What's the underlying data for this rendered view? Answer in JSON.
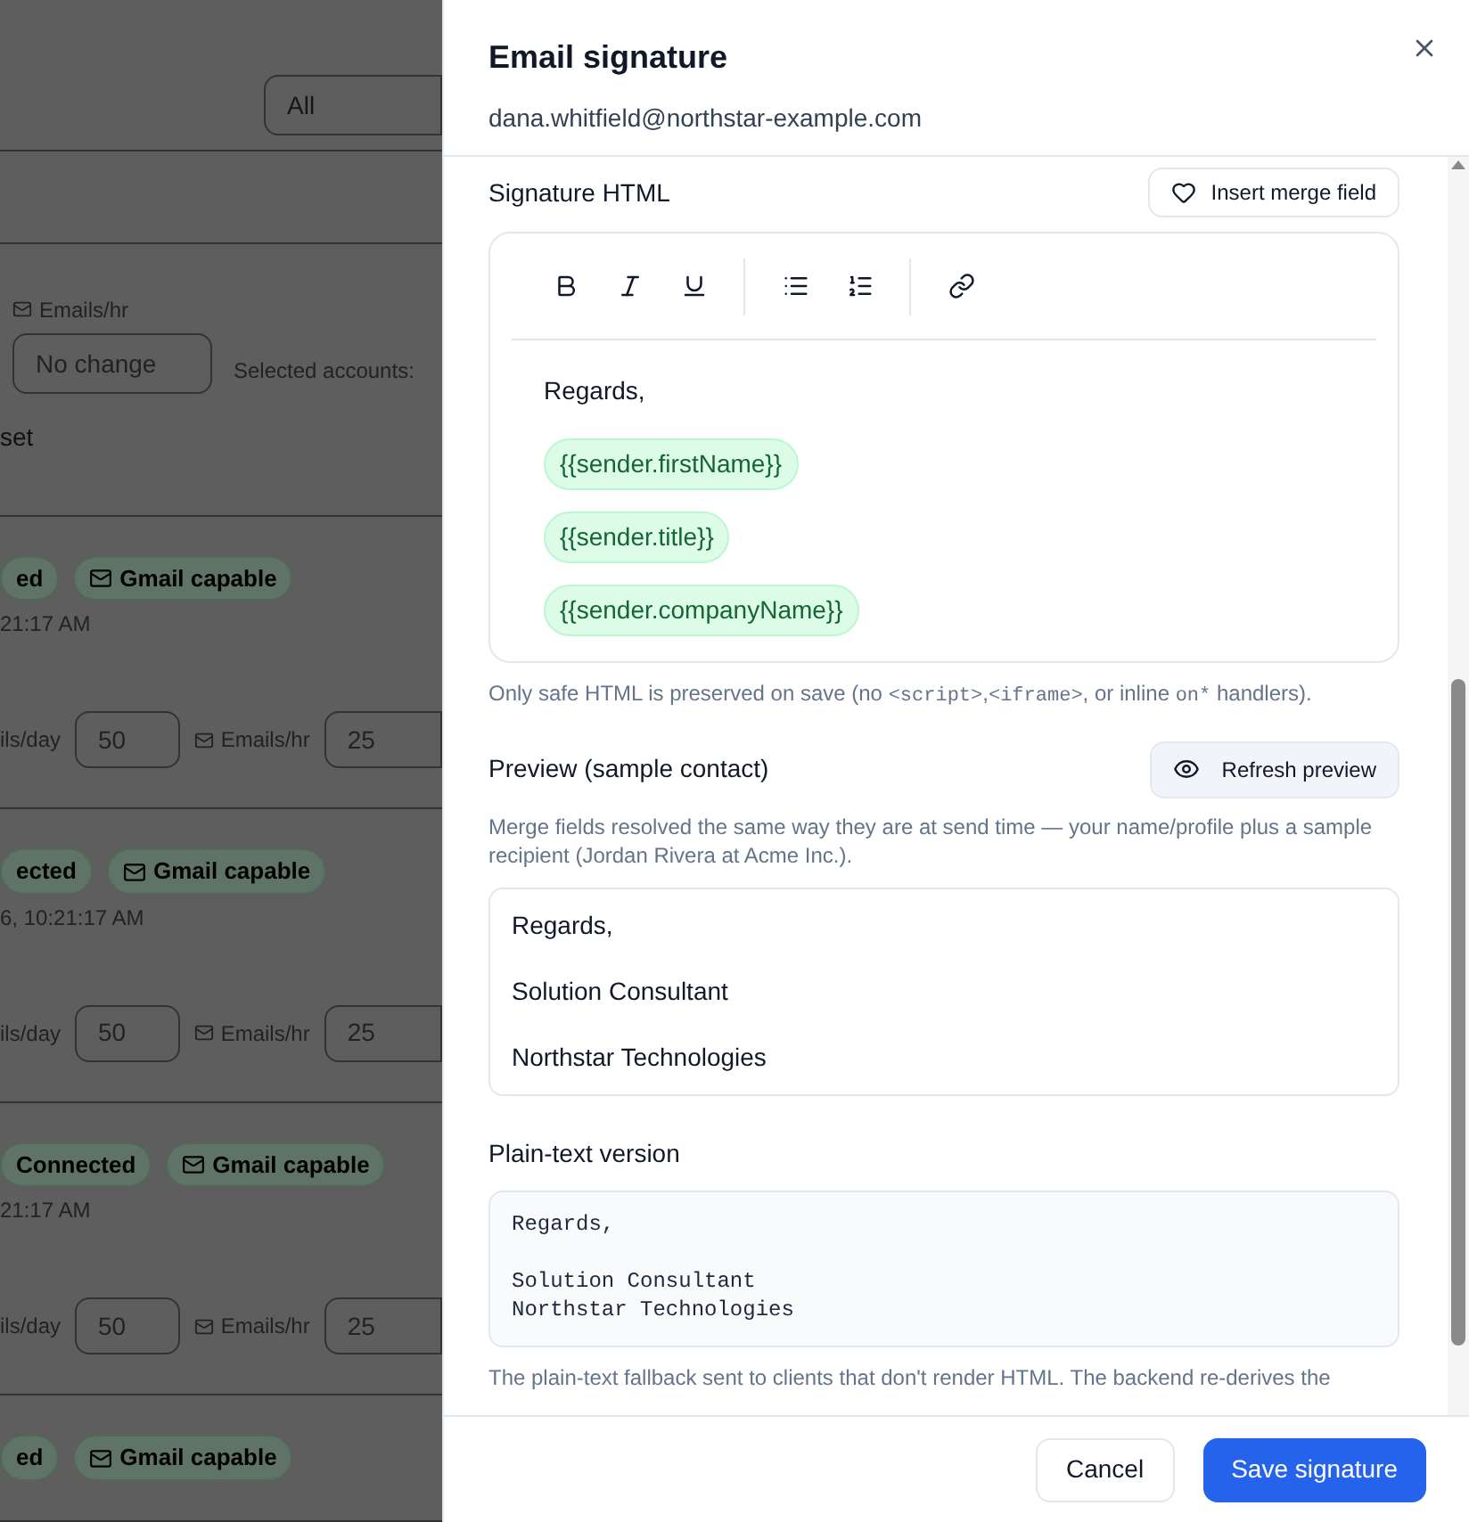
{
  "background": {
    "filter_select": {
      "value": "All"
    },
    "bulk": {
      "hr_label": "Emails/hr",
      "hr_placeholder": "No change",
      "selected_accounts": "Selected accounts:"
    },
    "section_heading": "set",
    "accounts": [
      {
        "status": "ed",
        "capability": "Gmail capable",
        "timestamp": "21:17 AM",
        "day_label": "ils/day",
        "day_value": "50",
        "hr_label": "Emails/hr",
        "hr_value": "25"
      },
      {
        "status": "ected",
        "capability": "Gmail capable",
        "timestamp": "6, 10:21:17 AM",
        "day_label": "ils/day",
        "day_value": "50",
        "hr_label": "Emails/hr",
        "hr_value": "25"
      },
      {
        "status": "Connected",
        "capability": "Gmail capable",
        "timestamp": "21:17 AM",
        "day_label": "ils/day",
        "day_value": "50",
        "hr_label": "Emails/hr",
        "hr_value": "25"
      },
      {
        "status": "ed",
        "capability": "Gmail capable"
      }
    ]
  },
  "panel": {
    "title": "Email signature",
    "email": "dana.whitfield@northstar-example.com",
    "signature_html": {
      "label": "Signature HTML",
      "insert_button": "Insert merge field",
      "lines": [
        {
          "kind": "text",
          "text": "Regards,"
        },
        {
          "kind": "merge_field",
          "text": "{{sender.firstName}}"
        },
        {
          "kind": "merge_field",
          "text": "{{sender.title}}"
        },
        {
          "kind": "merge_field",
          "text": "{{sender.companyName}}"
        }
      ],
      "hint": [
        {
          "kind": "text",
          "text": "Only safe HTML is preserved on save (no "
        },
        {
          "kind": "code",
          "text": "<script>"
        },
        {
          "kind": "text",
          "text": ","
        },
        {
          "kind": "code",
          "text": "<iframe>"
        },
        {
          "kind": "text",
          "text": ", or inline "
        },
        {
          "kind": "code",
          "text": "on*"
        },
        {
          "kind": "text",
          "text": " handlers)."
        }
      ]
    },
    "preview": {
      "label": "Preview (sample contact)",
      "refresh_button": "Refresh preview",
      "description": "Merge fields resolved the same way they are at send time — your name/profile plus a sample recipient (Jordan Rivera at Acme Inc.).",
      "lines": [
        "Regards,",
        "Solution Consultant",
        "Northstar Technologies"
      ]
    },
    "plain_text": {
      "label": "Plain-text version",
      "text": "Regards,\n\nSolution Consultant\nNorthstar Technologies",
      "note": "The plain-text fallback sent to clients that don't render HTML. The backend re-derives the"
    },
    "footer": {
      "cancel": "Cancel",
      "save": "Save signature"
    }
  }
}
